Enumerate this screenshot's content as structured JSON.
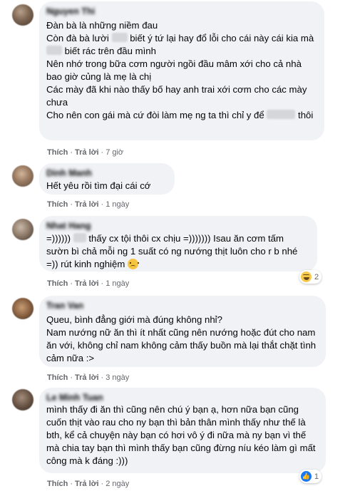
{
  "actions": {
    "like": "Thích",
    "reply": "Trả lời",
    "separator": "·"
  },
  "comments": [
    {
      "author": "Nguyen Thi",
      "time": "7 giờ",
      "lines": [
        "Đàn bà là những niềm đau",
        "Còn đà bà lười biết ý tứ lại hay đổ lỗi cho cái này cái kia mà biết rác trên đầu mình",
        "Nên nhớ trong bữa cơm người ngồi đầu mâm xới cho cả nhà bao giờ củng là mẹ là chị",
        "Các mày đã khi nào thấy bố hay anh trai xới cơm cho các mày chưa",
        "Cho nên con gái mà cứ đòi làm mẹ ng ta thì chỉ y để thôi"
      ]
    },
    {
      "author": "Dinh Manh",
      "time": "1 ngày",
      "text": "Hết yêu rồi tìm đại cái cớ"
    },
    {
      "author": "Nhat Hang",
      "time": "1 ngày",
      "text": "=))))))  thấy cx tội thôi cx chịu =)))))))  Isau ăn cơm tấm sườn bì chả mỗi ng 1 suất có ng nướng thịt luôn cho r b nhé =)) rút kinh nghiệm",
      "reaction_count": "2"
    },
    {
      "author": "Tran Van",
      "time": "3 ngày",
      "text": "Queu, bình đẳng giới mà đúng không nhỉ?\nNam nướng nữ ăn thì ít nhất cũng nên nướng hoặc đút cho nam ăn với, không chỉ nam không cảm thấy buồn mà lại thắt chặt tình cảm nữa :>"
    },
    {
      "author": "Le Minh Tuan",
      "time": "2 ngày",
      "text": "mình thấy đi ăn thì cũng nên chú ý bạn ạ, hơn nữa bạn cũng cuốn thịt vào rau cho ny bạn thì bản thân mình thấy như thế là bth, kể cả chuyện này bạn có hơi vô ý đi nữa mà ny bạn vì thế mà chia tay bạn thì mình thấy bạn cũng đừng níu kéo làm gì mất công mà k đáng :)))",
      "reaction_count": "1"
    }
  ]
}
